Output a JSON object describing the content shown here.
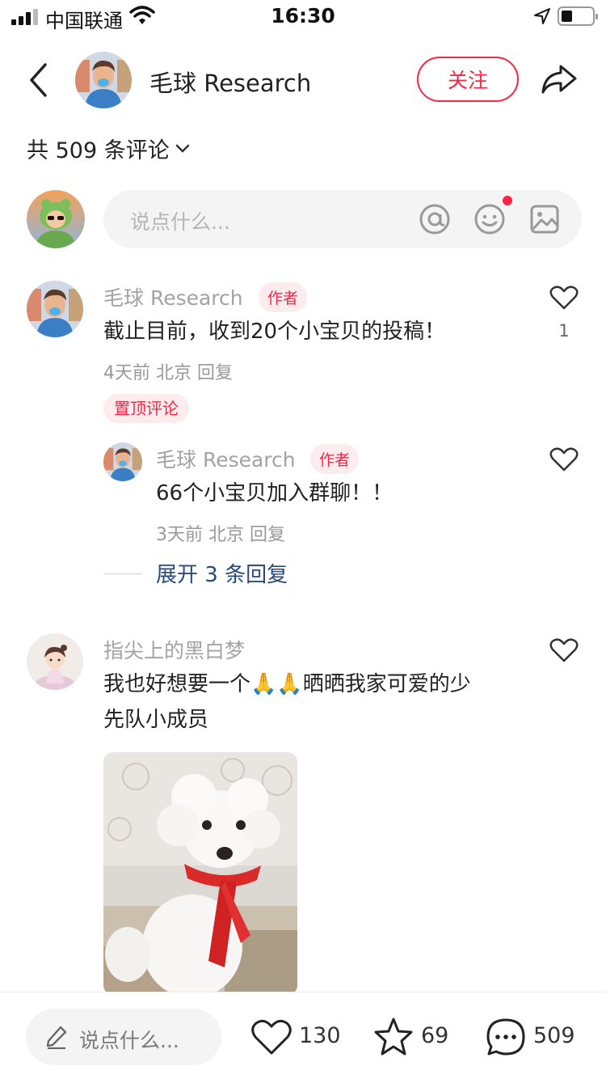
{
  "status_bar": {
    "carrier": "中国联通",
    "time": "16:30",
    "battery_level": 0.3
  },
  "header": {
    "account_name": "毛球 Research",
    "follow_label": "关注"
  },
  "comments_header": {
    "total_label": "共 509 条评论"
  },
  "compose": {
    "placeholder": "说点什么..."
  },
  "comments": [
    {
      "name": "毛球 Research",
      "badge": "作者",
      "text": "截止目前，收到20个小宝贝的投稿！",
      "meta": "4天前 北京 回复",
      "likes": "1",
      "pinned_label": "置顶评论",
      "replies": [
        {
          "name": "毛球 Research",
          "badge": "作者",
          "text": "66个小宝贝加入群聊！！",
          "meta": "3天前 北京 回复"
        }
      ],
      "expand_label": "展开 3 条回复"
    },
    {
      "name": "指尖上的黑白梦",
      "text_line1": "我也好想要一个🙏🙏晒晒我家可爱的少",
      "text_line2": "先队小成员"
    }
  ],
  "bottom_bar": {
    "input_placeholder": "说点什么...",
    "likes": "130",
    "favorites": "69",
    "comments": "509"
  },
  "colors": {
    "accent": "#ff2442",
    "link": "#2a4a7a",
    "input_bg": "#f4f4f4"
  },
  "icons": [
    "signal-icon",
    "wifi-icon",
    "location-arrow-icon",
    "battery-icon",
    "back-chevron-icon",
    "share-icon",
    "chevron-down-icon",
    "at-icon",
    "emoji-icon",
    "image-icon",
    "heart-icon",
    "pencil-icon",
    "star-icon",
    "comment-bubble-icon"
  ]
}
